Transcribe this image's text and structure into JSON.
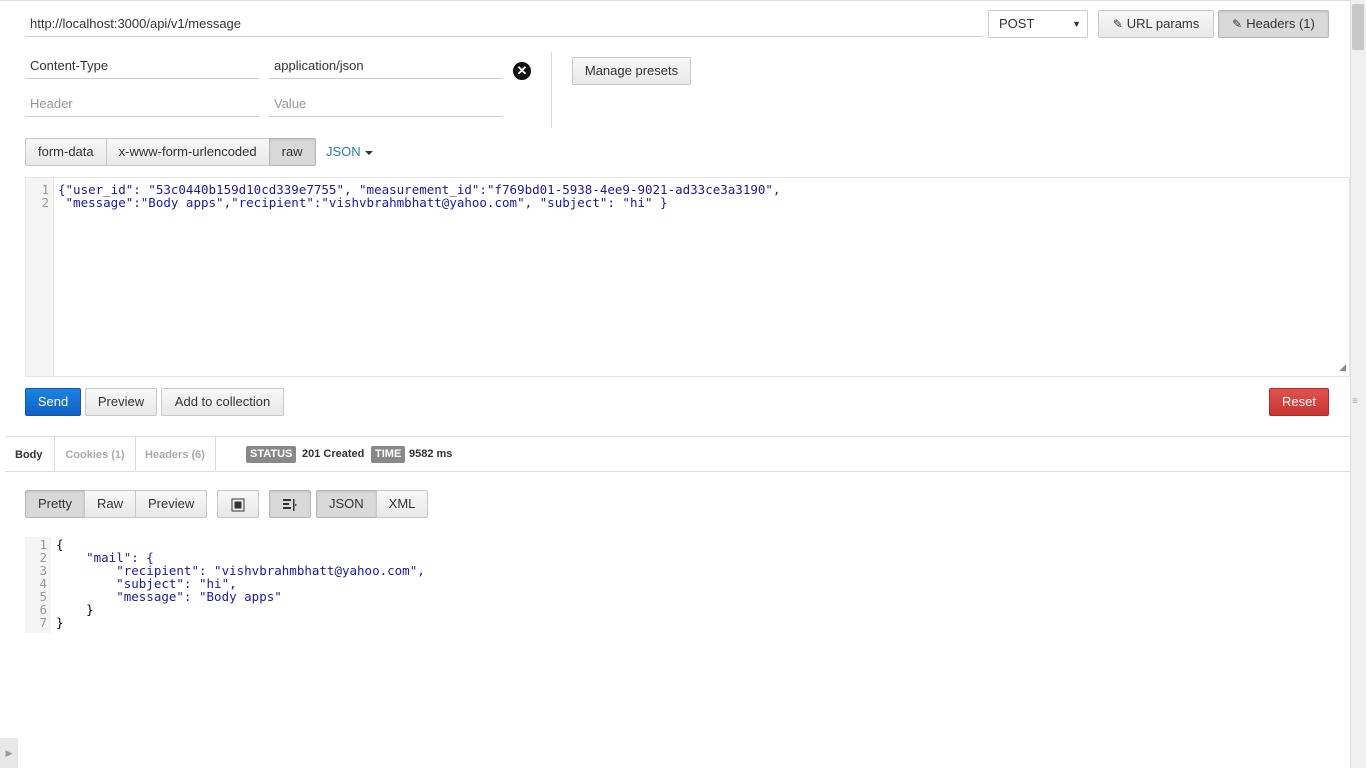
{
  "request": {
    "url": "http://localhost:3000/api/v1/message",
    "method": "POST",
    "url_params_label": "URL params",
    "headers_label": "Headers (1)"
  },
  "headers": {
    "rows": [
      {
        "key": "Content-Type",
        "value": "application/json"
      }
    ],
    "new_key_placeholder": "Header",
    "new_value_placeholder": "Value",
    "manage_presets_label": "Manage presets"
  },
  "body_type": {
    "options": [
      "form-data",
      "x-www-form-urlencoded",
      "raw"
    ],
    "selected": "raw",
    "format": "JSON"
  },
  "editor": {
    "line_numbers": [
      "1",
      "2"
    ],
    "lines": [
      "{\"user_id\": \"53c0440b159d10cd339e7755\", \"measurement_id\":\"f769bd01-5938-4ee9-9021-ad33ce3a3190\",",
      " \"message\":\"Body apps\",\"recipient\":\"vishvbrahmbhatt@yahoo.com\", \"subject\": \"hi\" }"
    ]
  },
  "actions": {
    "send": "Send",
    "preview": "Preview",
    "add_to_collection": "Add to collection",
    "reset": "Reset"
  },
  "response": {
    "tabs": [
      "Body",
      "Cookies (1)",
      "Headers (6)"
    ],
    "status_label": "STATUS",
    "status_value": "201 Created",
    "time_label": "TIME",
    "time_value": "9582 ms",
    "view_modes": [
      "Pretty",
      "Raw",
      "Preview"
    ],
    "formats": [
      "JSON",
      "XML"
    ],
    "line_numbers": [
      "1",
      "2",
      "3",
      "4",
      "5",
      "6",
      "7"
    ],
    "lines": [
      "{",
      "    \"mail\": {",
      "        \"recipient\": \"vishvbrahmbhatt@yahoo.com\",",
      "        \"subject\": \"hi\",",
      "        \"message\": \"Body apps\"",
      "    }",
      "}"
    ]
  },
  "colors": {
    "send": "#1570d6",
    "reset": "#d5403c",
    "string": "#1a1aa6",
    "link": "#2a7ab0"
  }
}
